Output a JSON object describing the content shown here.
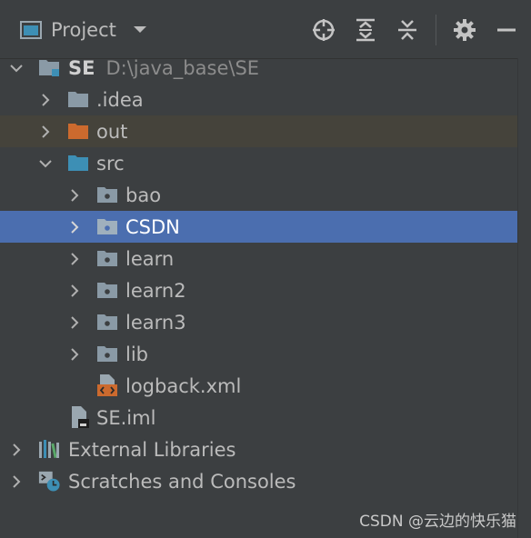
{
  "header": {
    "title": "Project",
    "tools": [
      "locate-icon",
      "expand-all-icon",
      "collapse-all-icon",
      "gear-icon",
      "minimize-icon"
    ]
  },
  "tree": {
    "root": {
      "name": "SE",
      "path": "D:\\java_base\\SE"
    },
    "idea": ".idea",
    "out": "out",
    "src": "src",
    "bao": "bao",
    "csdn": "CSDN",
    "learn": "learn",
    "learn2": "learn2",
    "learn3": "learn3",
    "lib": "lib",
    "logback": "logback.xml",
    "iml": "SE.iml",
    "external": "External Libraries",
    "scratches": "Scratches and Consoles"
  },
  "watermark": "CSDN @云边的快乐猫",
  "colors": {
    "background": "#3c3f41",
    "selection": "#4b6eaf",
    "out_highlight": "#45433b",
    "folder": "#8a9aa6",
    "out_folder": "#cc6a2e",
    "src_folder": "#3d8fb5"
  }
}
